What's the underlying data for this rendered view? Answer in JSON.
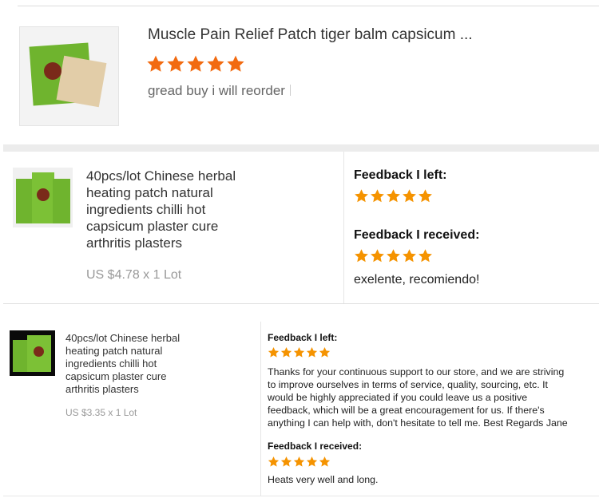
{
  "review1": {
    "title": "Muscle Pain Relief Patch tiger balm capsicum ...",
    "rating": 5,
    "comment": "gread buy i will reorder",
    "star_color": "#f26a10"
  },
  "order1": {
    "product_title_lines": [
      "40pcs/lot Chinese herbal",
      "heating patch natural",
      "ingredients chilli hot",
      "capsicum plaster cure",
      "arthritis plasters"
    ],
    "price": "US $4.78 x 1 Lot",
    "feedback_left_label": "Feedback I left:",
    "feedback_left_rating": 5,
    "feedback_received_label": "Feedback I received:",
    "feedback_received_rating": 5,
    "feedback_received_text": "exelente, recomiendo!",
    "star_color": "#f59300"
  },
  "order2": {
    "product_title_lines": [
      "40pcs/lot Chinese herbal",
      "heating patch natural",
      "ingredients chilli hot",
      "capsicum plaster cure",
      "arthritis plasters"
    ],
    "price": "US $3.35 x 1 Lot",
    "feedback_left_label": "Feedback I left:",
    "feedback_left_rating": 5,
    "feedback_left_text_lines": [
      "Thanks for your continuous support to our store, and we are striving",
      "to improve ourselves in terms of service, quality, sourcing, etc. It",
      "would be highly appreciated if you could leave us a positive",
      "feedback, which will be a great encouragement for us. If there's",
      "anything I can help with, don't hesitate to tell me. Best Regards Jane"
    ],
    "feedback_received_label": "Feedback I received:",
    "feedback_received_rating": 5,
    "feedback_received_text": "Heats very well and long.",
    "star_color": "#f59300"
  }
}
